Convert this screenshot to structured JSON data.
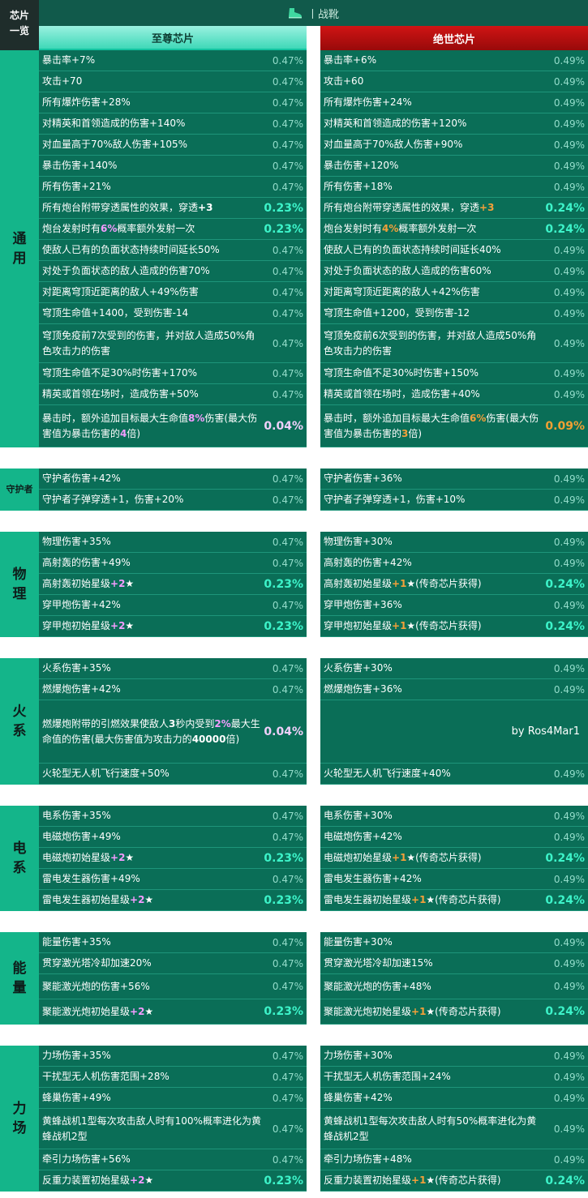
{
  "corner_title": [
    "芯片",
    "一览"
  ],
  "header": {
    "icon": "boot-icon",
    "title": "丨战靴"
  },
  "columns": {
    "left_title": "至尊芯片",
    "right_title": "绝世芯片"
  },
  "credit": "by Ros4Mar1",
  "colors": {
    "row_bg": "#0a6e57",
    "category_bg": "#14b58a",
    "left_header": "#3fd8b8",
    "right_header": "#c00f0f",
    "percent": "#93dcca",
    "highlight": "#3df3c9",
    "left_emphasis": "#f49cff",
    "right_emphasis": "#f3a03a"
  },
  "sections": [
    {
      "name": "通用",
      "small": false,
      "rows": [
        {
          "h": 26,
          "left": {
            "text": "暴击率+7%",
            "pct": "0.47%"
          },
          "right": {
            "text": "暴击率+6%",
            "pct": "0.49%"
          }
        },
        {
          "h": 26,
          "left": {
            "text": "攻击+70",
            "pct": "0.47%"
          },
          "right": {
            "text": "攻击+60",
            "pct": "0.49%"
          }
        },
        {
          "h": 26,
          "left": {
            "text": "所有爆炸伤害+28%",
            "pct": "0.47%"
          },
          "right": {
            "text": "所有爆炸伤害+24%",
            "pct": "0.49%"
          }
        },
        {
          "h": 26,
          "left": {
            "text": "对精英和首领造成的伤害+140%",
            "pct": "0.47%"
          },
          "right": {
            "text": "对精英和首领造成的伤害+120%",
            "pct": "0.49%"
          }
        },
        {
          "h": 26,
          "left": {
            "text": "对血量高于70%敌人伤害+105%",
            "pct": "0.47%"
          },
          "right": {
            "text": "对血量高于70%敌人伤害+90%",
            "pct": "0.49%"
          }
        },
        {
          "h": 26,
          "left": {
            "text": "暴击伤害+140%",
            "pct": "0.47%"
          },
          "right": {
            "text": "暴击伤害+120%",
            "pct": "0.49%"
          }
        },
        {
          "h": 26,
          "left": {
            "text": "所有伤害+21%",
            "pct": "0.47%"
          },
          "right": {
            "text": "所有伤害+18%",
            "pct": "0.49%"
          }
        },
        {
          "h": 26,
          "left": {
            "segs": [
              {
                "t": "所有炮台附带穿透属性的效果，穿透"
              },
              {
                "t": "+3",
                "c": "w"
              }
            ],
            "pct": "0.23%",
            "pst": "hi"
          },
          "right": {
            "segs": [
              {
                "t": "所有炮台附带穿透属性的效果，穿透"
              },
              {
                "t": "+3",
                "c": "r"
              }
            ],
            "pct": "0.24%",
            "pst": "hi"
          }
        },
        {
          "h": 26,
          "left": {
            "segs": [
              {
                "t": "炮台发射时有"
              },
              {
                "t": "6%",
                "c": "l"
              },
              {
                "t": "概率额外发射一次"
              }
            ],
            "pct": "0.23%",
            "pst": "hi"
          },
          "right": {
            "segs": [
              {
                "t": "炮台发射时有"
              },
              {
                "t": "4%",
                "c": "r"
              },
              {
                "t": "概率额外发射一次"
              }
            ],
            "pct": "0.24%",
            "pst": "hi"
          }
        },
        {
          "h": 26,
          "left": {
            "text": "使敌人已有的负面状态持续时间延长50%",
            "pct": "0.47%"
          },
          "right": {
            "text": "使敌人已有的负面状态持续时间延长40%",
            "pct": "0.49%"
          }
        },
        {
          "h": 26,
          "left": {
            "text": "对处于负面状态的敌人造成的伤害70%",
            "pct": "0.47%"
          },
          "right": {
            "text": "对处于负面状态的敌人造成的伤害60%",
            "pct": "0.49%"
          }
        },
        {
          "h": 26,
          "left": {
            "text": "对距离穹顶近距离的敌人+49%伤害",
            "pct": "0.47%"
          },
          "right": {
            "text": "对距离穹顶近距离的敌人+42%伤害",
            "pct": "0.49%"
          }
        },
        {
          "h": 26,
          "left": {
            "text": "穹顶生命值+1400，受到伤害-14",
            "pct": "0.47%"
          },
          "right": {
            "text": "穹顶生命值+1200，受到伤害-12",
            "pct": "0.49%"
          }
        },
        {
          "h": 48,
          "left": {
            "text": "穹顶免疫前7次受到的伤害，并对敌人造成50%角色攻击力的伤害",
            "pct": "0.47%"
          },
          "right": {
            "text": "穹顶免疫前6次受到的伤害，并对敌人造成50%角色攻击力的伤害",
            "pct": "0.49%"
          }
        },
        {
          "h": 26,
          "left": {
            "text": "穹顶生命值不足30%时伤害+170%",
            "pct": "0.47%"
          },
          "right": {
            "text": "穹顶生命值不足30%时伤害+150%",
            "pct": "0.49%"
          }
        },
        {
          "h": 26,
          "left": {
            "text": "精英或首领在场时，造成伤害+50%",
            "pct": "0.47%"
          },
          "right": {
            "text": "精英或首领在场时，造成伤害+40%",
            "pct": "0.49%"
          }
        },
        {
          "h": 52,
          "left": {
            "segs": [
              {
                "t": "暴击时，额外追加目标最大生命值"
              },
              {
                "t": "8%",
                "c": "l"
              },
              {
                "t": "伤害(最大伤害值为暴击伤害的"
              },
              {
                "t": "4",
                "c": "l"
              },
              {
                "t": "倍)"
              }
            ],
            "pct": "0.04%",
            "pst": "pk"
          },
          "right": {
            "segs": [
              {
                "t": "暴击时，额外追加目标最大生命值"
              },
              {
                "t": "6%",
                "c": "r"
              },
              {
                "t": "伤害(最大伤害值为暴击伤害的"
              },
              {
                "t": "3",
                "c": "r"
              },
              {
                "t": "倍)"
              }
            ],
            "pct": "0.09%",
            "pst": "or"
          }
        }
      ]
    },
    {
      "name": "守护者",
      "small": true,
      "rows": [
        {
          "h": 26,
          "left": {
            "text": "守护者伤害+42%",
            "pct": "0.47%"
          },
          "right": {
            "text": "守护者伤害+36%",
            "pct": "0.49%"
          }
        },
        {
          "h": 26,
          "left": {
            "text": "守护者子弹穿透+1，伤害+20%",
            "pct": "0.47%"
          },
          "right": {
            "text": "守护者子弹穿透+1，伤害+10%",
            "pct": "0.49%"
          }
        }
      ]
    },
    {
      "name": "物理",
      "small": false,
      "rows": [
        {
          "h": 26,
          "left": {
            "text": "物理伤害+35%",
            "pct": "0.47%"
          },
          "right": {
            "text": "物理伤害+30%",
            "pct": "0.49%"
          }
        },
        {
          "h": 26,
          "left": {
            "text": "高射轰的伤害+49%",
            "pct": "0.47%"
          },
          "right": {
            "text": "高射轰的伤害+42%",
            "pct": "0.49%"
          }
        },
        {
          "h": 26,
          "left": {
            "segs": [
              {
                "t": "高射轰初始星级"
              },
              {
                "t": "+2",
                "c": "l"
              },
              {
                "t": "★",
                "c": "w"
              }
            ],
            "pct": "0.23%",
            "pst": "hi"
          },
          "right": {
            "segs": [
              {
                "t": "高射轰初始星级"
              },
              {
                "t": "+1",
                "c": "r"
              },
              {
                "t": "★(传奇芯片获得)"
              }
            ],
            "pct": "0.24%",
            "pst": "hi"
          }
        },
        {
          "h": 26,
          "left": {
            "text": "穿甲炮伤害+42%",
            "pct": "0.47%"
          },
          "right": {
            "text": "穿甲炮伤害+36%",
            "pct": "0.49%"
          }
        },
        {
          "h": 26,
          "left": {
            "segs": [
              {
                "t": "穿甲炮初始星级"
              },
              {
                "t": "+2",
                "c": "l"
              },
              {
                "t": "★",
                "c": "w"
              }
            ],
            "pct": "0.23%",
            "pst": "hi"
          },
          "right": {
            "segs": [
              {
                "t": "穿甲炮初始星级"
              },
              {
                "t": "+1",
                "c": "r"
              },
              {
                "t": "★(传奇芯片获得)"
              }
            ],
            "pct": "0.24%",
            "pst": "hi"
          }
        }
      ]
    },
    {
      "name": "火系",
      "small": false,
      "rows": [
        {
          "h": 26,
          "left": {
            "text": "火系伤害+35%",
            "pct": "0.47%"
          },
          "right": {
            "text": "火系伤害+30%",
            "pct": "0.49%"
          }
        },
        {
          "h": 26,
          "left": {
            "text": "燃爆炮伤害+42%",
            "pct": "0.47%"
          },
          "right": {
            "text": "燃爆炮伤害+36%",
            "pct": "0.49%"
          }
        },
        {
          "h": 78,
          "left": {
            "segs": [
              {
                "t": "燃爆炮附带的引燃效果使敌人"
              },
              {
                "t": "3",
                "c": "w"
              },
              {
                "t": "秒内受到"
              },
              {
                "t": "2%",
                "c": "l"
              },
              {
                "t": "最大生命值的伤害(最大伤害值为攻击力的"
              },
              {
                "t": "40000",
                "c": "w"
              },
              {
                "t": "倍)"
              }
            ],
            "pct": "0.04%",
            "pst": "pk"
          },
          "right": {
            "credit": true
          }
        },
        {
          "h": 26,
          "left": {
            "text": "火轮型无人机飞行速度+50%",
            "pct": "0.47%"
          },
          "right": {
            "text": "火轮型无人机飞行速度+40%",
            "pct": "0.49%"
          }
        }
      ]
    },
    {
      "name": "电系",
      "small": false,
      "rows": [
        {
          "h": 26,
          "left": {
            "text": "电系伤害+35%",
            "pct": "0.47%"
          },
          "right": {
            "text": "电系伤害+30%",
            "pct": "0.49%"
          }
        },
        {
          "h": 26,
          "left": {
            "text": "电磁炮伤害+49%",
            "pct": "0.47%"
          },
          "right": {
            "text": "电磁炮伤害+42%",
            "pct": "0.49%"
          }
        },
        {
          "h": 26,
          "left": {
            "segs": [
              {
                "t": "电磁炮初始星级"
              },
              {
                "t": "+2",
                "c": "l"
              },
              {
                "t": "★",
                "c": "w"
              }
            ],
            "pct": "0.23%",
            "pst": "hi"
          },
          "right": {
            "segs": [
              {
                "t": "电磁炮初始星级"
              },
              {
                "t": "+1",
                "c": "r"
              },
              {
                "t": "★(传奇芯片获得)"
              }
            ],
            "pct": "0.24%",
            "pst": "hi"
          }
        },
        {
          "h": 26,
          "left": {
            "text": "雷电发生器伤害+49%",
            "pct": "0.47%"
          },
          "right": {
            "text": "雷电发生器伤害+42%",
            "pct": "0.49%"
          }
        },
        {
          "h": 26,
          "left": {
            "segs": [
              {
                "t": "雷电发生器初始星级"
              },
              {
                "t": "+2",
                "c": "l"
              },
              {
                "t": "★",
                "c": "w"
              }
            ],
            "pct": "0.23%",
            "pst": "hi"
          },
          "right": {
            "segs": [
              {
                "t": "雷电发生器初始星级"
              },
              {
                "t": "+1",
                "c": "r"
              },
              {
                "t": "★(传奇芯片获得)"
              }
            ],
            "pct": "0.24%",
            "pst": "hi"
          }
        }
      ]
    },
    {
      "name": "能量",
      "small": false,
      "rows": [
        {
          "h": 26,
          "left": {
            "text": "能量伤害+35%",
            "pct": "0.47%"
          },
          "right": {
            "text": "能量伤害+30%",
            "pct": "0.49%"
          }
        },
        {
          "h": 26,
          "left": {
            "text": "贯穿激光塔冷却加速20%",
            "pct": "0.47%"
          },
          "right": {
            "text": "贯穿激光塔冷却加速15%",
            "pct": "0.49%"
          }
        },
        {
          "h": 31,
          "left": {
            "text": "聚能激光炮的伤害+56%",
            "pct": "0.47%"
          },
          "right": {
            "text": "聚能激光炮的伤害+48%",
            "pct": "0.49%"
          }
        },
        {
          "h": 31,
          "left": {
            "segs": [
              {
                "t": "聚能激光炮初始星级"
              },
              {
                "t": "+2",
                "c": "l"
              },
              {
                "t": "★",
                "c": "w"
              }
            ],
            "pct": "0.23%",
            "pst": "hi"
          },
          "right": {
            "segs": [
              {
                "t": "聚能激光炮初始星级"
              },
              {
                "t": "+1",
                "c": "r"
              },
              {
                "t": "★(传奇芯片获得)"
              }
            ],
            "pct": "0.24%",
            "pst": "hi"
          }
        }
      ]
    },
    {
      "name": "力场",
      "small": false,
      "rows": [
        {
          "h": 26,
          "left": {
            "text": "力场伤害+35%",
            "pct": "0.47%"
          },
          "right": {
            "text": "力场伤害+30%",
            "pct": "0.49%"
          }
        },
        {
          "h": 26,
          "left": {
            "text": "干扰型无人机伤害范围+28%",
            "pct": "0.47%"
          },
          "right": {
            "text": "干扰型无人机伤害范围+24%",
            "pct": "0.49%"
          }
        },
        {
          "h": 26,
          "left": {
            "text": "蜂巢伤害+49%",
            "pct": "0.47%"
          },
          "right": {
            "text": "蜂巢伤害+42%",
            "pct": "0.49%"
          }
        },
        {
          "h": 50,
          "left": {
            "text": "黄蜂战机1型每次攻击敌人时有100%概率进化为黄蜂战机2型",
            "pct": "0.47%"
          },
          "right": {
            "text": "黄蜂战机1型每次攻击敌人时有50%概率进化为黄蜂战机2型",
            "pct": "0.49%"
          }
        },
        {
          "h": 26,
          "left": {
            "text": "牵引力场伤害+56%",
            "pct": "0.47%"
          },
          "right": {
            "text": "牵引力场伤害+48%",
            "pct": "0.49%"
          }
        },
        {
          "h": 26,
          "left": {
            "segs": [
              {
                "t": "反重力装置初始星级"
              },
              {
                "t": "+2",
                "c": "l"
              },
              {
                "t": "★",
                "c": "w"
              }
            ],
            "pct": "0.23%",
            "pst": "hi"
          },
          "right": {
            "segs": [
              {
                "t": "反重力装置初始星级"
              },
              {
                "t": "+1",
                "c": "r"
              },
              {
                "t": "★(传奇芯片获得)"
              }
            ],
            "pct": "0.24%",
            "pst": "hi"
          }
        }
      ]
    }
  ]
}
